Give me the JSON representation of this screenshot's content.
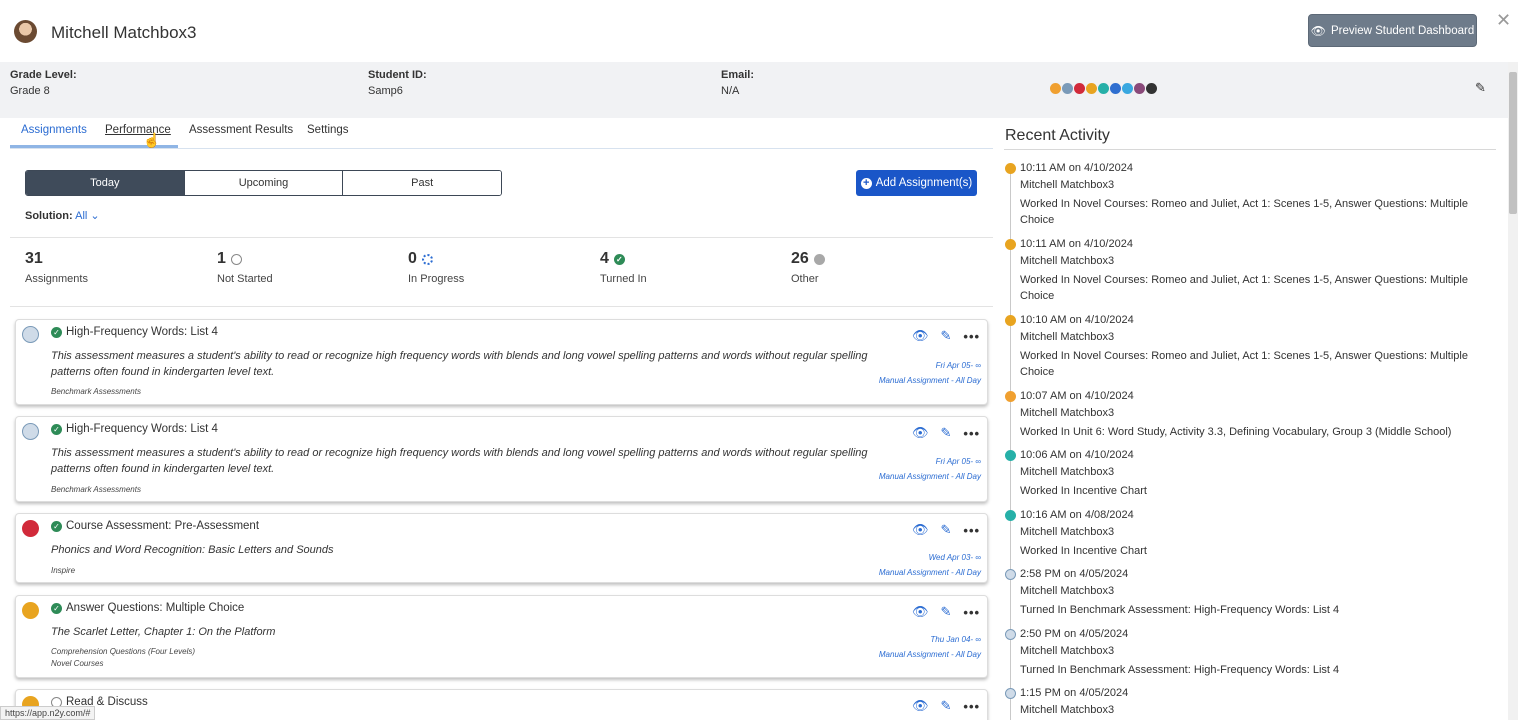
{
  "header": {
    "student_name": "Mitchell Matchbox3",
    "preview_label": "Preview Student Dashboard"
  },
  "info": {
    "grade_label": "Grade Level:",
    "grade_value": "Grade 8",
    "id_label": "Student ID:",
    "id_value": "Samp6",
    "email_label": "Email:",
    "email_value": "N/A"
  },
  "tabs": [
    "Assignments",
    "Performance",
    "Assessment Results",
    "Settings"
  ],
  "segments": [
    "Today",
    "Upcoming",
    "Past"
  ],
  "add_label": "Add Assignment(s)",
  "solution": {
    "label": "Solution:",
    "value": "All"
  },
  "stats": [
    {
      "num": "31",
      "cap": "Assignments"
    },
    {
      "num": "1",
      "cap": "Not Started"
    },
    {
      "num": "0",
      "cap": "In Progress"
    },
    {
      "num": "4",
      "cap": "Turned In"
    },
    {
      "num": "26",
      "cap": "Other"
    }
  ],
  "cards": [
    {
      "title": "High-Frequency Words: List 4",
      "desc": "This assessment measures a student's ability to read or recognize high frequency words with blends and long vowel spelling patterns and words without regular spelling patterns often found in kindergarten level text.",
      "cat1": "Benchmark Assessments",
      "cat2": "",
      "date": "Fri Apr 05- ∞",
      "mode": "Manual Assignment - All Day"
    },
    {
      "title": "High-Frequency Words: List 4",
      "desc": "This assessment measures a student's ability to read or recognize high frequency words with blends and long vowel spelling patterns and words without regular spelling patterns often found in kindergarten level text.",
      "cat1": "Benchmark Assessments",
      "cat2": "",
      "date": "Fri Apr 05- ∞",
      "mode": "Manual Assignment - All Day"
    },
    {
      "title": "Course Assessment: Pre-Assessment",
      "desc": "Phonics and Word Recognition: Basic Letters and Sounds",
      "cat1": "Inspire",
      "cat2": "",
      "date": "Wed Apr 03- ∞",
      "mode": "Manual Assignment - All Day"
    },
    {
      "title": "Answer Questions: Multiple Choice",
      "desc": "The Scarlet Letter, Chapter 1: On the Platform",
      "cat1": "Comprehension Questions (Four Levels)",
      "cat2": "Novel Courses",
      "date": "Thu Jan 04- ∞",
      "mode": "Manual Assignment - All Day"
    },
    {
      "title": "Read & Discuss",
      "desc": "",
      "cat1": "",
      "cat2": "",
      "date": "",
      "mode": ""
    }
  ],
  "recent": {
    "title": "Recent Activity",
    "items": [
      {
        "time": "10:11 AM on 4/10/2024",
        "who": "Mitchell Matchbox3",
        "what": "Worked In Novel Courses: Romeo and Juliet, Act 1: Scenes 1-5, Answer Questions: Multiple Choice"
      },
      {
        "time": "10:11 AM on 4/10/2024",
        "who": "Mitchell Matchbox3",
        "what": "Worked In Novel Courses: Romeo and Juliet, Act 1: Scenes 1-5, Answer Questions: Multiple Choice"
      },
      {
        "time": "10:10 AM on 4/10/2024",
        "who": "Mitchell Matchbox3",
        "what": "Worked In Novel Courses: Romeo and Juliet, Act 1: Scenes 1-5, Answer Questions: Multiple Choice"
      },
      {
        "time": "10:07 AM on 4/10/2024",
        "who": "Mitchell Matchbox3",
        "what": "Worked In Unit 6: Word Study, Activity 3.3, Defining Vocabulary, Group 3 (Middle School)"
      },
      {
        "time": "10:06 AM on 4/10/2024",
        "who": "Mitchell Matchbox3",
        "what": "Worked In Incentive Chart"
      },
      {
        "time": "10:16 AM on 4/08/2024",
        "who": "Mitchell Matchbox3",
        "what": "Worked In Incentive Chart"
      },
      {
        "time": "2:58 PM on 4/05/2024",
        "who": "Mitchell Matchbox3",
        "what": "Turned In Benchmark Assessment: High-Frequency Words: List 4"
      },
      {
        "time": "2:50 PM on 4/05/2024",
        "who": "Mitchell Matchbox3",
        "what": "Turned In Benchmark Assessment: High-Frequency Words: List 4"
      },
      {
        "time": "1:15 PM on 4/05/2024",
        "who": "Mitchell Matchbox3",
        "what": ""
      }
    ]
  },
  "status_url": "https://app.n2y.com/#",
  "colors": {
    "primary": "#1a56c8",
    "turned_in": "#2e8b57",
    "dark_seg": "#3f4b5a"
  }
}
